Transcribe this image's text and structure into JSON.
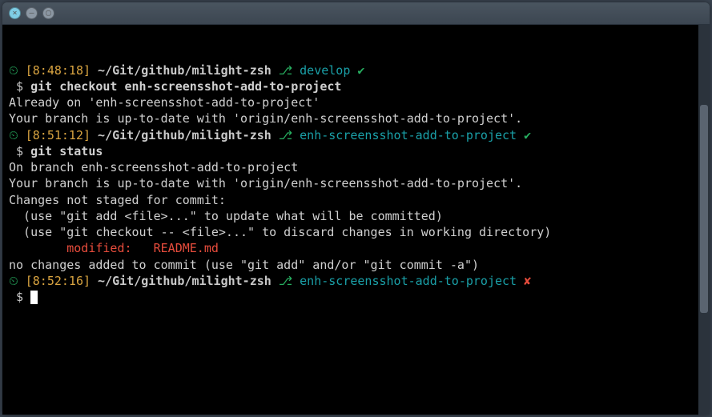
{
  "window": {
    "buttons": {
      "close": "×",
      "minimize": "–",
      "maximize": "▢"
    }
  },
  "blocks": [
    {
      "prompt": {
        "clock": "⏲",
        "time": "[8:48:18]",
        "path": "~/Git/github/milight-zsh",
        "branch_icon": "⎇",
        "branch": "develop",
        "status": "✔",
        "status_kind": "ok"
      },
      "cmd": "git checkout enh-screensshot-add-to-project",
      "output": [
        {
          "text": "Already on 'enh-screensshot-add-to-project'"
        },
        {
          "text": "Your branch is up-to-date with 'origin/enh-screensshot-add-to-project'."
        }
      ]
    },
    {
      "prompt": {
        "clock": "⏲",
        "time": "[8:51:12]",
        "path": "~/Git/github/milight-zsh",
        "branch_icon": "⎇",
        "branch": "enh-screensshot-add-to-project",
        "status": "✔",
        "status_kind": "ok"
      },
      "cmd": "git status",
      "output": [
        {
          "text": "On branch enh-screensshot-add-to-project"
        },
        {
          "text": "Your branch is up-to-date with 'origin/enh-screensshot-add-to-project'."
        },
        {
          "text": ""
        },
        {
          "text": "Changes not staged for commit:"
        },
        {
          "text": "  (use \"git add <file>...\" to update what will be committed)"
        },
        {
          "text": "  (use \"git checkout -- <file>...\" to discard changes in working directory)"
        },
        {
          "text": ""
        },
        {
          "text": "        modified:   README.md",
          "class": "red"
        },
        {
          "text": ""
        },
        {
          "text": "no changes added to commit (use \"git add\" and/or \"git commit -a\")"
        }
      ]
    },
    {
      "prompt": {
        "clock": "⏲",
        "time": "[8:52:16]",
        "path": "~/Git/github/milight-zsh",
        "branch_icon": "⎇",
        "branch": "enh-screensshot-add-to-project",
        "status": "✘",
        "status_kind": "bad"
      },
      "cmd": "",
      "cursor": true,
      "output": []
    }
  ]
}
